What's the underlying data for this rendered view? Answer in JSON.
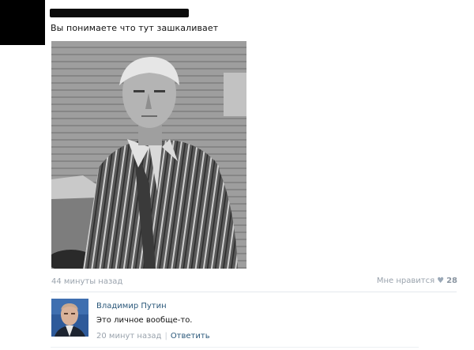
{
  "post": {
    "text": "Вы понимаете что тут зашкаливает",
    "time": "44 минуты назад",
    "likes_label": "Мне нравится",
    "likes_count": "28"
  },
  "comment": {
    "author": "Владимир Путин",
    "text": "Это личное вообще-то.",
    "time": "20 минут назад",
    "separator": "|",
    "reply_label": "Ответить"
  },
  "icons": {
    "like": "heart-icon"
  }
}
